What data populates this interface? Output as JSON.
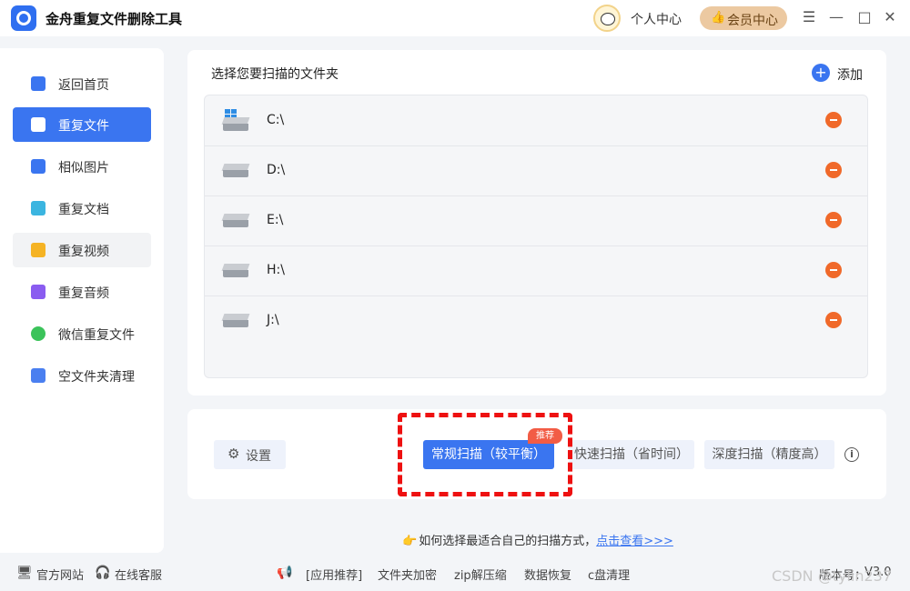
{
  "app": {
    "title": "金舟重复文件删除工具"
  },
  "header": {
    "profile_label": "个人中心",
    "vip_label": "会员中心"
  },
  "window_controls": {
    "menu": "☰",
    "minimize": "—",
    "maximize": "□",
    "close": "✕"
  },
  "sidebar": {
    "items": [
      {
        "label": "返回首页",
        "icon": "home-icon",
        "color": "#3a75f0"
      },
      {
        "label": "重复文件",
        "icon": "folder-icon",
        "color": "#ffffff"
      },
      {
        "label": "相似图片",
        "icon": "image-icon",
        "color": "#3a75f0"
      },
      {
        "label": "重复文档",
        "icon": "document-icon",
        "color": "#3bb5e0"
      },
      {
        "label": "重复视频",
        "icon": "video-icon",
        "color": "#f5b324"
      },
      {
        "label": "重复音频",
        "icon": "audio-icon",
        "color": "#8a5cf0"
      },
      {
        "label": "微信重复文件",
        "icon": "wechat-icon",
        "color": "#3bc35a"
      },
      {
        "label": "空文件夹清理",
        "icon": "empty-folder-icon",
        "color": "#4a7ff0"
      }
    ],
    "active_index": 1
  },
  "folders": {
    "title": "选择您要扫描的文件夹",
    "add_label": "添加",
    "items": [
      {
        "path": "C:\\",
        "type": "windows-drive"
      },
      {
        "path": "D:\\",
        "type": "drive"
      },
      {
        "path": "E:\\",
        "type": "drive"
      },
      {
        "path": "H:\\",
        "type": "drive"
      },
      {
        "path": "J:\\",
        "type": "drive"
      }
    ]
  },
  "scan": {
    "settings_label": "设置",
    "normal_label": "常规扫描（较平衡）",
    "fast_label": "快速扫描（省时间）",
    "deep_label": "深度扫描（精度高）",
    "recommend_badge": "推荐",
    "info_glyph": "i"
  },
  "tip": {
    "text": "如何选择最适合自己的扫描方式，",
    "link": "点击查看>>>"
  },
  "footer": {
    "website": "官方网站",
    "support": "在线客服",
    "recommend": "[应用推荐]",
    "links": [
      "文件夹加密",
      "zip解压缩",
      "数据恢复",
      "c盘清理"
    ],
    "version_label": "版本号：",
    "version": "V3.0"
  },
  "watermark": "CSDN @tylin237",
  "colors": {
    "accent": "#3a75f0",
    "remove": "#f0692a",
    "vip": "#ecc9a1",
    "highlight": "#ee1111"
  }
}
